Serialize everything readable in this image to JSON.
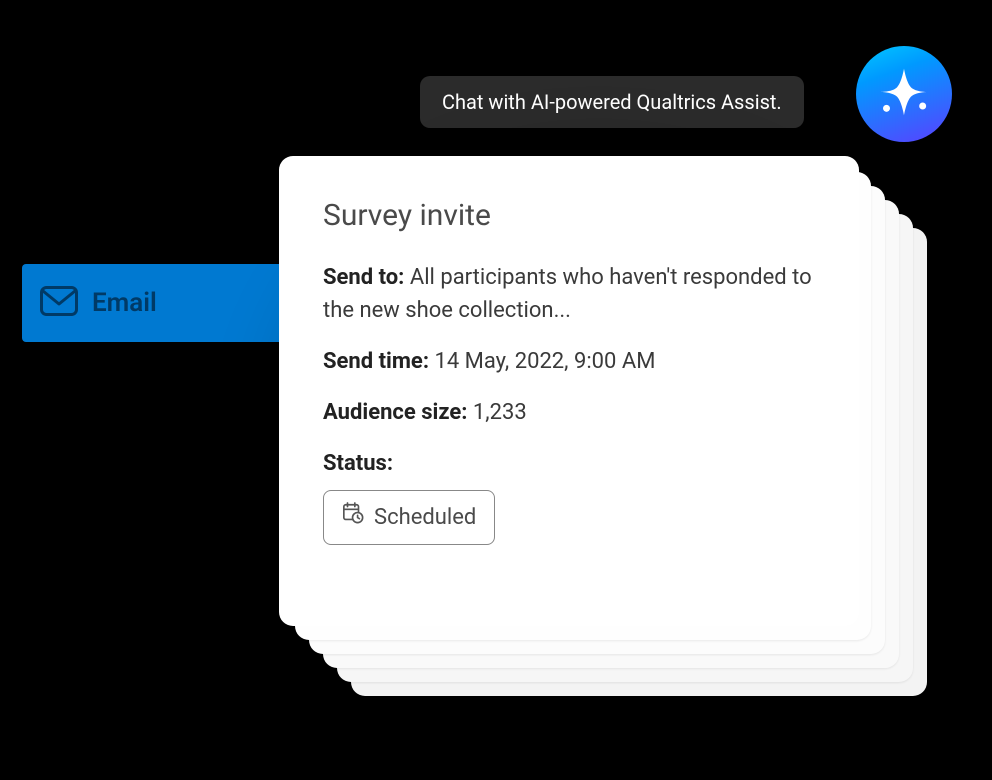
{
  "chat_tooltip": {
    "text": "Chat with AI-powered Qualtrics Assist."
  },
  "email_tab": {
    "label": "Email"
  },
  "card": {
    "title": "Survey invite",
    "send_to_label": "Send to:",
    "send_to_value": " All participants who haven't responded to the new shoe collection...",
    "send_time_label": "Send time:",
    "send_time_value": " 14 May, 2022, 9:00 AM",
    "audience_size_label": "Audience size:",
    "audience_size_value": " 1,233",
    "status_label": "Status:",
    "status_badge": "Scheduled"
  }
}
